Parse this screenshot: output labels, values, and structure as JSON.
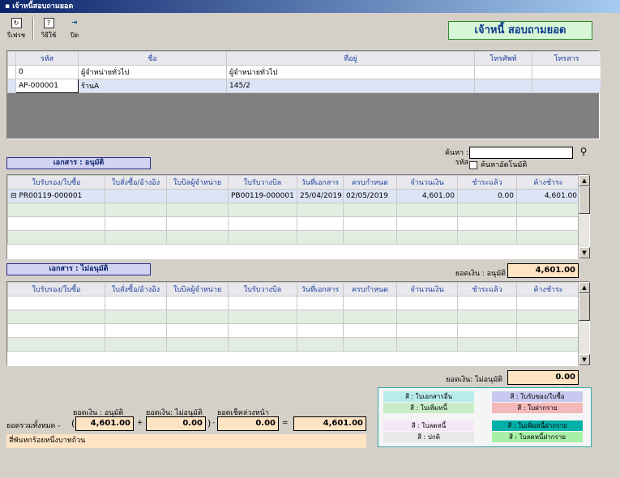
{
  "window": {
    "title": "เจ้าหนี้สอบถามยอด"
  },
  "toolbar": {
    "refresh": "รีเฟรช",
    "help": "วิธีใช้",
    "close": "ปิด"
  },
  "heading": "เจ้าหนี้ สอบถามยอด",
  "creditors": {
    "columns": [
      "รหัส",
      "ชื่อ",
      "ที่อยู่",
      "โทรศัพท์",
      "โทรสาร"
    ],
    "rows": [
      [
        "0",
        "ผู้จำหน่ายทั่วไป",
        "ผู้จำหน่ายทั่วไป",
        "",
        ""
      ],
      [
        "AP-000001",
        "ร้านA",
        "145/2",
        "",
        ""
      ]
    ]
  },
  "search": {
    "label": "ค้นหา : รหัส",
    "value": "",
    "auto_label": "ค้นหาอัตโนมัติ",
    "auto_checked": false
  },
  "approved": {
    "label": "เอกสาร : อนุมัติ",
    "columns": [
      "ใบรับรอง/ใบซื้อ",
      "ใบสั่งซื้อ/อ้างอิง",
      "ใบบิลผู้จำหน่าย",
      "ใบรับวางบิล",
      "วันที่เอกสาร",
      "ครบกำหนด",
      "จำนวนเงิน",
      "ชำระแล้ว",
      "ค้างชำระ"
    ],
    "rows": [
      [
        "PR00119-000001",
        "",
        "",
        "PB00119-000001",
        "25/04/2019",
        "02/05/2019",
        "4,601.00",
        "0.00",
        "4,601.00"
      ]
    ],
    "balance_label": "ยอดเงิน : อนุมัติ",
    "balance": "4,601.00"
  },
  "unapproved": {
    "label": "เอกสาร : ไม่อนุมัติ",
    "columns": [
      "ใบรับรอง/ใบซื้อ",
      "ใบสั่งซื้อ/อ้างอิง",
      "ใบบิลผู้จำหน่าย",
      "ใบรับวางบิล",
      "วันที่เอกสาร",
      "ครบกำหนด",
      "จำนวนเงิน",
      "ชำระแล้ว",
      "ค้างชำระ"
    ],
    "balance_label": "ยอดเงิน: ไม่อนุมัติ",
    "balance": "0.00"
  },
  "totals": {
    "label": "ยอดรวมทั้งหมด -",
    "approved_label": "ยอดเงิน : อนุมัติ",
    "unapproved_label": "ยอดเงิน: ไม่อนุมัติ",
    "advance_label": "ยอดเช็คล่วงหน้า",
    "approved": "4,601.00",
    "unapproved": "0.00",
    "advance": "0.00",
    "total": "4,601.00",
    "plus": "+",
    "minus": "-",
    "equals": "=",
    "open_paren": "(",
    "close_paren": ")",
    "in_words": "สี่พันหกร้อยหนึ่งบาทถ้วน"
  },
  "legend": [
    {
      "text": "สี : ใบเอกสารอื่น",
      "color": "#b8ecec"
    },
    {
      "text": "สี : ใบรับของ/ใบซื้อ",
      "color": "#c8c8f0"
    },
    {
      "text": "สี : ใบเพิ่มหนี้",
      "color": "#c8ecc8"
    },
    {
      "text": "สี : ใบฝากราย",
      "color": "#f4b8b8"
    },
    {
      "text": "สี : ใบลดหนี้",
      "color": "#f6e6f6"
    },
    {
      "text": "สี : ใบเพิ่มหนี้ฝากราย",
      "color": "#00b0a8"
    },
    {
      "text": "สี : ปกติ",
      "color": "#e8e8e8"
    },
    {
      "text": "สี : ใบลดหนี้ฝากราย",
      "color": "#a8f0a8"
    }
  ]
}
